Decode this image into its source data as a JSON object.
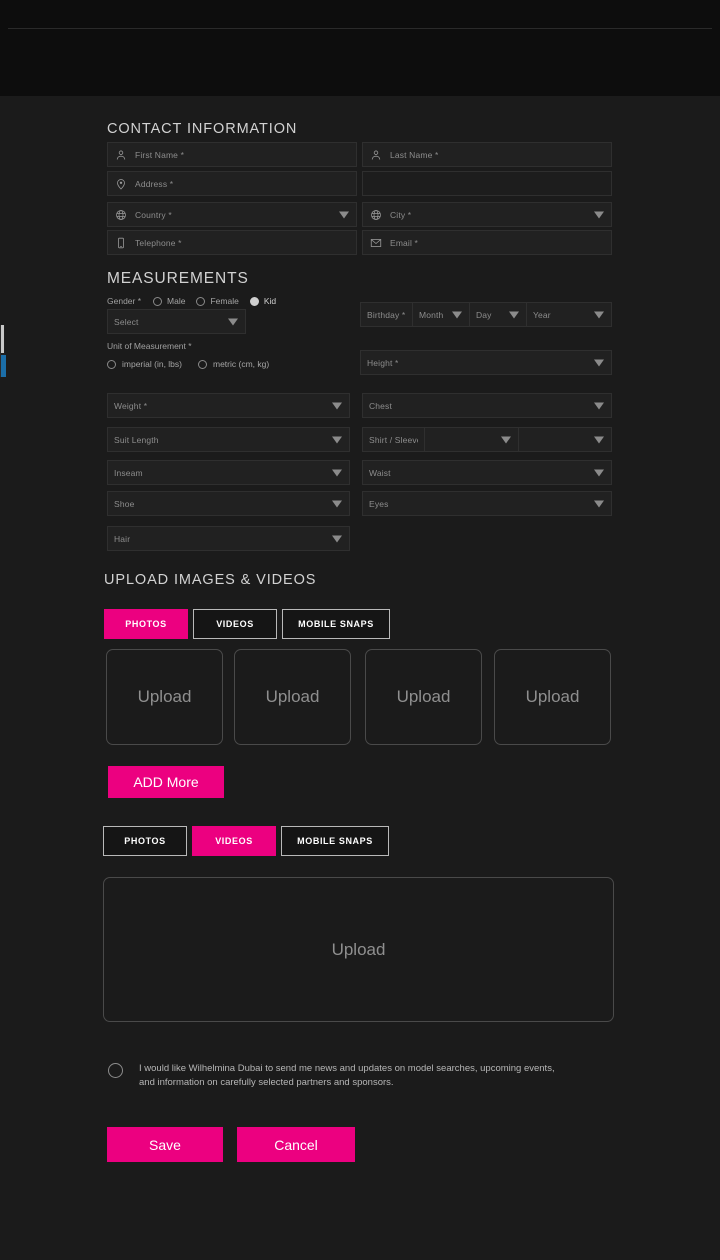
{
  "theme": {
    "accent": "#EC0080",
    "background": "#1b1b1b",
    "header_bg": "#0d0d0d",
    "field_bg": "#212121"
  },
  "contact": {
    "title": "CONTACT INFORMATION",
    "fields": [
      {
        "label": "First Name *",
        "icon": "person-icon",
        "type": "text"
      },
      {
        "label": "Last Name *",
        "icon": "person-icon",
        "type": "text"
      },
      {
        "label": "Address *",
        "icon": "location-pin-icon",
        "type": "text"
      },
      {
        "label": "",
        "icon": "none",
        "type": "text"
      },
      {
        "label": "Country *",
        "icon": "globe-icon",
        "type": "select"
      },
      {
        "label": "City *",
        "icon": "globe-icon",
        "type": "select"
      },
      {
        "label": "Telephone *",
        "icon": "phone-icon",
        "type": "text"
      },
      {
        "label": "Email *",
        "icon": "envelope-icon",
        "type": "text"
      }
    ]
  },
  "measurements": {
    "title": "MEASUREMENTS",
    "gender_label": "Gender *",
    "gender_options": [
      {
        "label": "Male",
        "selected": false
      },
      {
        "label": "Female",
        "selected": false
      },
      {
        "label": "Kid",
        "selected": true
      }
    ],
    "gender_select_placeholder": "Select",
    "unit_label": "Unit of Measurement *",
    "unit_options": [
      {
        "label": "imperial (in, lbs)",
        "selected": false
      },
      {
        "label": "metric (cm, kg)",
        "selected": false
      }
    ],
    "birthday_label": "Birthday *",
    "birthday_parts": [
      "Month",
      "Day",
      "Year"
    ],
    "height_label": "Height *",
    "left_selects": [
      "Weight *",
      "Suit Length",
      "Inseam",
      "Shoe",
      "Hair"
    ],
    "right_selects": [
      "Chest",
      "Waist",
      "Eyes"
    ],
    "shirt_sleeve_label": "Shirt / Sleeve"
  },
  "uploads": {
    "title": "UPLOAD IMAGES & VIDEOS",
    "photo_tabs": [
      {
        "label": "PHOTOS",
        "active": true
      },
      {
        "label": "VIDEOS",
        "active": false
      },
      {
        "label": "MOBILE SNAPS",
        "active": false
      }
    ],
    "photo_slots": [
      "Upload",
      "Upload",
      "Upload",
      "Upload"
    ],
    "add_more_label": "ADD More",
    "video_tabs": [
      {
        "label": "PHOTOS",
        "active": false
      },
      {
        "label": "VIDEOS",
        "active": true
      },
      {
        "label": "MOBILE SNAPS",
        "active": false
      }
    ],
    "video_slot": "Upload"
  },
  "consent": {
    "line1": "I would like Wilhelmina Dubai to send me news and updates on model searches, upcoming events,",
    "line2": "and information on carefully selected partners and sponsors.",
    "checked": false
  },
  "actions": {
    "save_label": "Save",
    "cancel_label": "Cancel"
  }
}
